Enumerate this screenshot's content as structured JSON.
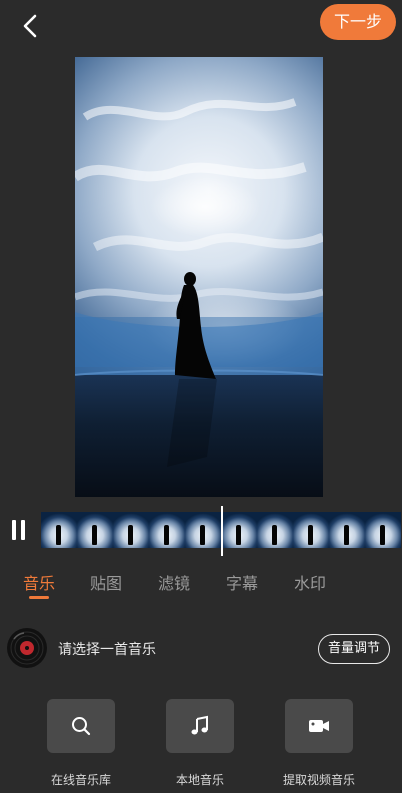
{
  "header": {
    "back_icon": "chevron-left-icon",
    "next_label": "下一步"
  },
  "player": {
    "state_icon": "pause-icon",
    "frame_count": 10,
    "playhead_fraction": 0.5
  },
  "tabs": [
    {
      "label": "音乐",
      "active": true
    },
    {
      "label": "贴图",
      "active": false
    },
    {
      "label": "滤镜",
      "active": false
    },
    {
      "label": "字幕",
      "active": false
    },
    {
      "label": "水印",
      "active": false
    }
  ],
  "music": {
    "prompt": "请选择一首音乐",
    "volume_label": "音量调节"
  },
  "sources": [
    {
      "label": "在线音乐库",
      "icon": "search-icon"
    },
    {
      "label": "本地音乐",
      "icon": "music-note-icon"
    },
    {
      "label": "提取视频音乐",
      "icon": "video-camera-icon"
    }
  ],
  "colors": {
    "accent": "#f07a3a",
    "background": "#2b2b2b",
    "button_bg": "#4a4a4a"
  }
}
